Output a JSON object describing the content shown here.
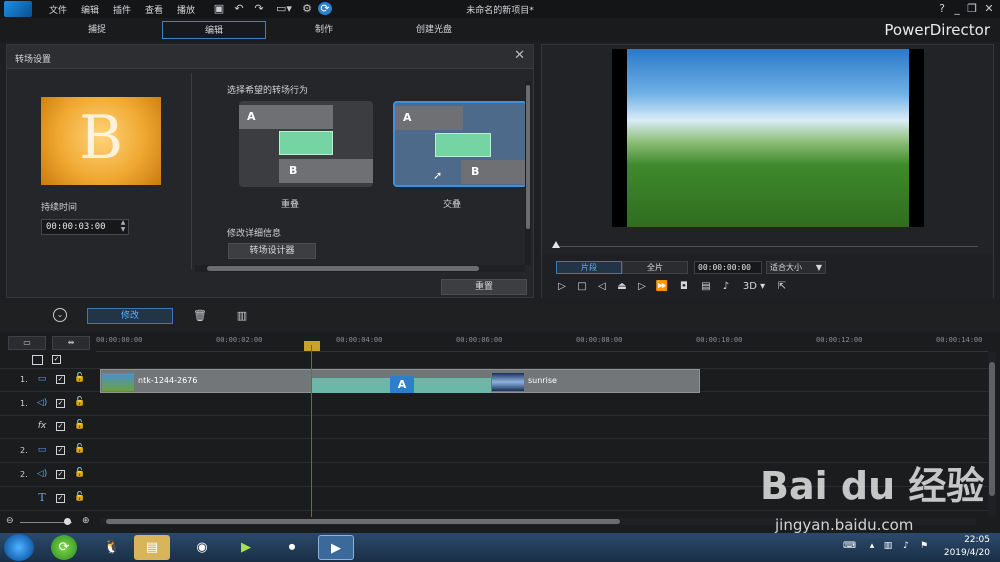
{
  "titlebar": {
    "menus": [
      "文件",
      "编辑",
      "插件",
      "查看",
      "播放"
    ],
    "document_title": "未命名的新项目*",
    "help": "?",
    "window_buttons": [
      "minimize-icon",
      "restore-icon",
      "close-icon"
    ]
  },
  "modes": {
    "tabs": [
      "捕捉",
      "编辑",
      "制作",
      "创建光盘"
    ],
    "active": "编辑",
    "brand": "PowerDirector"
  },
  "transition_panel": {
    "title": "转场设置",
    "thumb_letter": "B",
    "duration_label": "持续时间",
    "duration_value": "00:00:03:00",
    "behavior_label": "选择希望的转场行为",
    "options": [
      {
        "name": "重叠",
        "lane_a": "A",
        "lane_b": "B"
      },
      {
        "name": "交叠",
        "lane_a": "A",
        "lane_b": "B"
      }
    ],
    "selected_option": "交叠",
    "detail_label": "修改详细信息",
    "designer_button": "转场设计器",
    "reset_button": "重置"
  },
  "preview": {
    "segment_button": "片段",
    "full_button": "全片",
    "timecode": "00:00:00:00",
    "fit_select": "适合大小",
    "threed": "3D",
    "active_segment": "片段"
  },
  "toolbar": {
    "modify_button": "修改"
  },
  "timeline": {
    "ticks": [
      "00:00:00:00",
      "00:00:02:00",
      "00:00:04:00",
      "00:00:06:00",
      "00:00:08:00",
      "00:00:10:00",
      "00:00:12:00",
      "00:00:14:00"
    ],
    "tracks": [
      {
        "num": "",
        "icon": "video-track-icon"
      },
      {
        "num": "1.",
        "icon": "video-track-icon"
      },
      {
        "num": "1.",
        "icon": "audio-track-icon"
      },
      {
        "num": "",
        "icon": "fx-icon"
      },
      {
        "num": "2.",
        "icon": "video-track-icon"
      },
      {
        "num": "2.",
        "icon": "audio-track-icon"
      },
      {
        "num": "",
        "icon": "title-track-icon"
      }
    ],
    "clips": [
      {
        "name": "ntk-1244-2676"
      },
      {
        "name": "sunrise"
      }
    ],
    "transition_letter": "A"
  },
  "taskbar": {
    "time": "22:05",
    "date": "2019/4/20"
  },
  "watermark": {
    "brand": "Bai du 经验",
    "url": "jingyan.baidu.com"
  },
  "colors": {
    "accent": "#3d8fe0",
    "transition_green": "#74d4a3",
    "playhead": "#dd3333"
  }
}
